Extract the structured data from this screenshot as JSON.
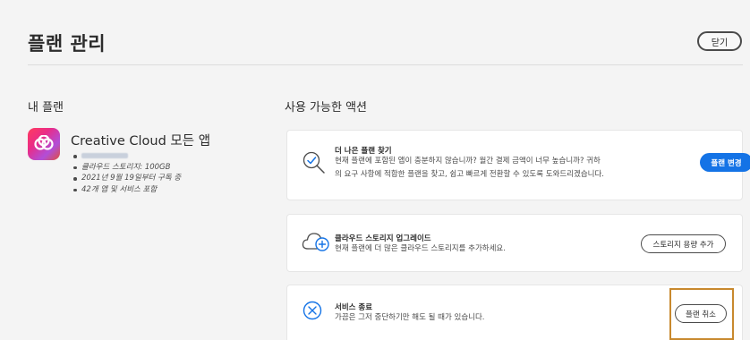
{
  "header": {
    "title": "플랜 관리",
    "close_label": "닫기"
  },
  "my_plan": {
    "heading": "내 플랜",
    "app_name": "Creative Cloud 모든 앱",
    "details": [
      "클라우드 스토리지: 100GB",
      "2021년 9월 19일부터 구독 중",
      "42개 앱 및 서비스 포함"
    ]
  },
  "actions": {
    "heading": "사용 가능한 액션",
    "cards": [
      {
        "title": "더 나은 플랜 찾기",
        "description_line1": "현재 플랜에 포함된 앱이 충분하지 않습니까? 월간 결제 금액이 너무 높습니까? 귀하",
        "description_line2": "의 요구 사항에 적합한 플랜을 찾고, 쉽고 빠르게 전환할 수 있도록 도와드리겠습니다.",
        "button_label": "플랜 변경",
        "icon": "magnifier-check-icon"
      },
      {
        "title": "클라우드 스토리지 업그레이드",
        "description_line1": "현재 플랜에 더 많은 클라우드 스토리지를 추가하세요.",
        "button_label": "스토리지 용량 추가",
        "icon": "cloud-plus-icon"
      },
      {
        "title": "서비스 종료",
        "description_line1": "가끔은 그저 중단하기만 해도 될 때가 있습니다.",
        "button_label": "플랜 취소",
        "icon": "circle-x-icon"
      }
    ]
  },
  "colors": {
    "accent": "#1473e6",
    "highlight": "#c8892e",
    "background": "#f4f4f4"
  }
}
